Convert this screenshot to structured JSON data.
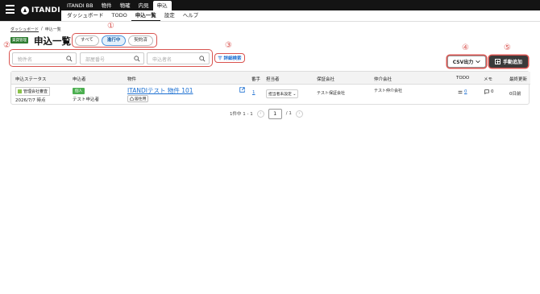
{
  "global_nav": {
    "brand": "ITANDI",
    "tabs": [
      "ITANDI BB",
      "物件",
      "物確",
      "内見",
      "申込"
    ],
    "active_tab": "申込"
  },
  "sub_nav": {
    "tabs": [
      "ダッシュボード",
      "TODO",
      "申込一覧",
      "設定",
      "ヘルプ"
    ],
    "active_tab": "申込一覧"
  },
  "breadcrumb": [
    "ダッシュボード",
    "/",
    "申込一覧"
  ],
  "page": {
    "badge": "賃貸管理",
    "title": "申込一覧"
  },
  "status_filters": [
    {
      "label": "すべて",
      "active": false
    },
    {
      "label": "進行中",
      "active": true
    },
    {
      "label": "契約済",
      "active": false
    }
  ],
  "search": {
    "property_placeholder": "物件名",
    "room_placeholder": "部屋番号",
    "applicant_placeholder": "申込者名",
    "advanced_label": "詳細検索"
  },
  "toolbar": {
    "csv_label": "CSV出力",
    "add_label": "手動追加"
  },
  "annotations": [
    "①",
    "②",
    "③",
    "④",
    "⑤"
  ],
  "table": {
    "headers": [
      "申込ステータス",
      "申込者",
      "物件",
      "番手",
      "担当者",
      "保証会社",
      "仲介会社",
      "TODO",
      "メモ",
      "最終更新"
    ],
    "rows": [
      {
        "status": "管理会社審査",
        "date": "2026/7/7 時点",
        "applicant_tag": "個人",
        "applicant": "テスト申込者",
        "property": "ITANDIテスト 物件 101",
        "property_type": "居住用",
        "order": "1",
        "staff": "担当者未設定",
        "guarantor": "テスト保証会社",
        "broker": "テスト仲介会社",
        "todo": "0",
        "memo": "0",
        "updated": "0日前"
      }
    ]
  },
  "pagination": {
    "summary": "1件中 1 - 1",
    "current": "1",
    "total": "/ 1"
  },
  "colors": {
    "annotation": "#d9534f",
    "link": "#1b6fd1",
    "active_pill": "#e3f0fb",
    "rental_badge": "#2e7d32",
    "add_button": "#3a3a3a"
  }
}
